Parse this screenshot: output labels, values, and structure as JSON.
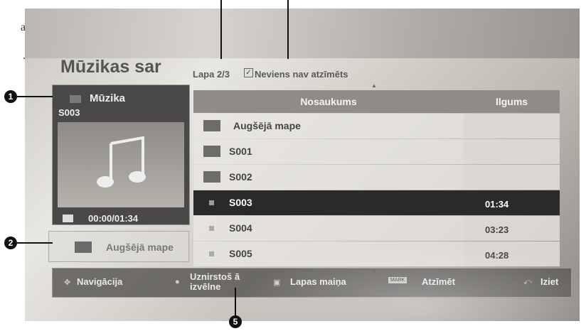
{
  "page_text": [
    "a",
    "."
  ],
  "screen": {
    "title": "Mūzikas sar",
    "page_info": "Lapa 2/3",
    "mark_status": "Neviens nav atzīmēts",
    "preview": {
      "label": "Mūzika",
      "name": "S003",
      "time": "00:00/01:34"
    },
    "up_button": "Augšējā mape",
    "columns": [
      "Nosaukums",
      "Ilgums"
    ],
    "rows": [
      {
        "name": "Augšējā mape",
        "duration": "",
        "type": "up-folder"
      },
      {
        "name": "S001",
        "duration": "",
        "type": "folder"
      },
      {
        "name": "S002",
        "duration": "",
        "type": "folder"
      },
      {
        "name": "S003",
        "duration": "01:34",
        "type": "file",
        "selected": true
      },
      {
        "name": "S004",
        "duration": "03:23",
        "type": "file"
      },
      {
        "name": "S005",
        "duration": "04:28",
        "type": "file"
      }
    ],
    "bottom_bar": {
      "nav": "Navigācija",
      "popup_line1": "Uznirstoš ā",
      "popup_line2": "izvēlne",
      "page_change": "Lapas maiņa",
      "mark_badge": "MARK",
      "mark": "Atzīmēt",
      "exit": "Iziet"
    }
  },
  "callouts": [
    "1",
    "2",
    "5"
  ],
  "icons": [
    "music-icon",
    "stop-icon",
    "folder-up-icon",
    "nav-arrows-icon",
    "popup-icon",
    "page-switch-icon",
    "back-icon",
    "checkbox-icon"
  ]
}
